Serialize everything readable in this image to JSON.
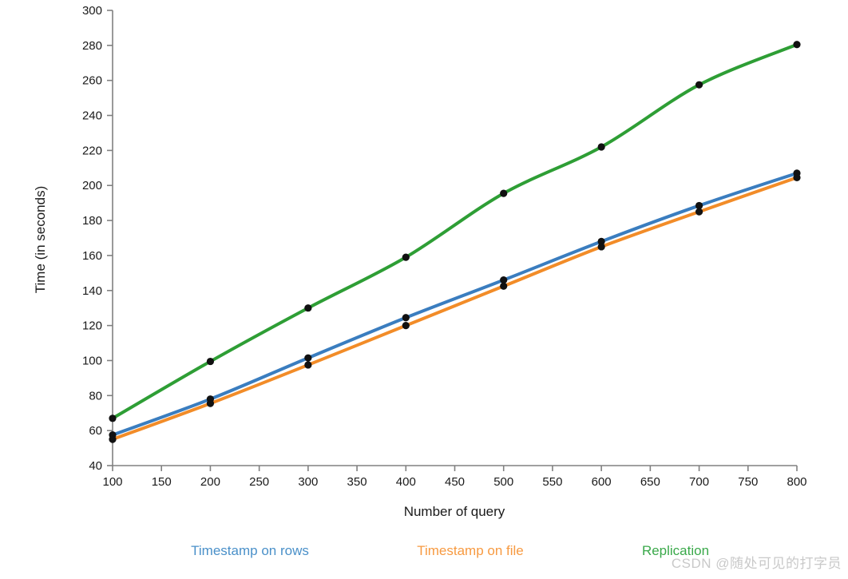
{
  "chart_data": {
    "type": "line",
    "title": "",
    "xlabel": "Number of query",
    "ylabel": "Time (in seconds)",
    "x": [
      100,
      200,
      300,
      400,
      500,
      600,
      700,
      800
    ],
    "xlim": [
      100,
      800
    ],
    "ylim": [
      40,
      300
    ],
    "xticks": [
      100,
      150,
      200,
      250,
      300,
      350,
      400,
      450,
      500,
      550,
      600,
      650,
      700,
      750,
      800
    ],
    "yticks": [
      40,
      60,
      80,
      100,
      120,
      140,
      160,
      180,
      200,
      220,
      240,
      260,
      280,
      300
    ],
    "grid": false,
    "legend_position": "bottom",
    "markers": "filled-circle-black",
    "series": [
      {
        "name": "Timestamp on rows",
        "color": "#3a7dbf",
        "values": [
          57.5,
          78,
          101.5,
          124.5,
          146,
          168,
          188.5,
          207
        ]
      },
      {
        "name": "Timestamp on file",
        "color": "#f28c28",
        "values": [
          55,
          75.5,
          97.5,
          120,
          142.5,
          165,
          185,
          204.5
        ]
      },
      {
        "name": "Replication",
        "color": "#2e9e35",
        "values": [
          67,
          99.5,
          130,
          159,
          195.5,
          222,
          257.5,
          280.5
        ]
      }
    ]
  },
  "legend": {
    "items": [
      {
        "label": "Timestamp on rows",
        "color": "#4a90c9"
      },
      {
        "label": "Timestamp on file",
        "color": "#f79a41"
      },
      {
        "label": "Replication",
        "color": "#3aa94a"
      }
    ]
  },
  "watermark": {
    "text": "CSDN @随处可见的打字员"
  },
  "colors": {
    "axis": "#808080",
    "text": "#1a1a1a",
    "background": "#ffffff",
    "marker": "#111111"
  }
}
